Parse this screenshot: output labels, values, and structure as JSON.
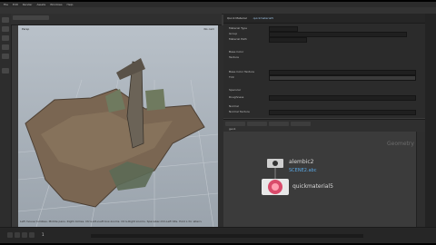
{
  "menubar": {
    "items": [
      "File",
      "Edit",
      "Render",
      "Assets",
      "Windows",
      "Help"
    ]
  },
  "viewport": {
    "corner_tl": "Persp",
    "corner_tr": "No cam",
    "status": "Left mouse tumbles. Middle pans. Right dollies. Ctrl+Alt+Left box-zooms. Ctrl+Right zooms. Spacebar-Ctrl-Left tilts. Hold L for alternate tumble, dolly, and zoom."
  },
  "parameter_panel": {
    "title": "Quick Material",
    "node_name": "quickmaterial5",
    "rows": [
      {
        "label": "Material Type",
        "value": "Principled Shader"
      },
      {
        "label": "Group",
        "value": ""
      },
      {
        "label": "Material Path",
        "value": "/mat/mat_1"
      },
      {
        "label": "Base Color",
        "value": ""
      },
      {
        "label": "Texture",
        "value": ""
      },
      {
        "label": "Base Color Texture",
        "value": "$HIP/textures/scene2.jpg"
      },
      {
        "label": "Tint",
        "value": ""
      },
      {
        "label": "Specular",
        "value": ""
      },
      {
        "label": "Roughness",
        "value": ""
      },
      {
        "label": "Normal",
        "value": ""
      },
      {
        "label": "Normal Texture",
        "value": ""
      }
    ]
  },
  "network": {
    "context": "geo1",
    "watermark": "Geometry",
    "nodes": [
      {
        "name": "alembic2",
        "subtitle": "SCENE2.abc"
      },
      {
        "name": "quickmaterial5",
        "subtitle": ""
      }
    ]
  },
  "timeline": {
    "frame": "1"
  },
  "colors": {
    "accent": "#5aa9e6",
    "node_sphere": "#d94b6b",
    "mesh_brown": "#7a6652"
  }
}
